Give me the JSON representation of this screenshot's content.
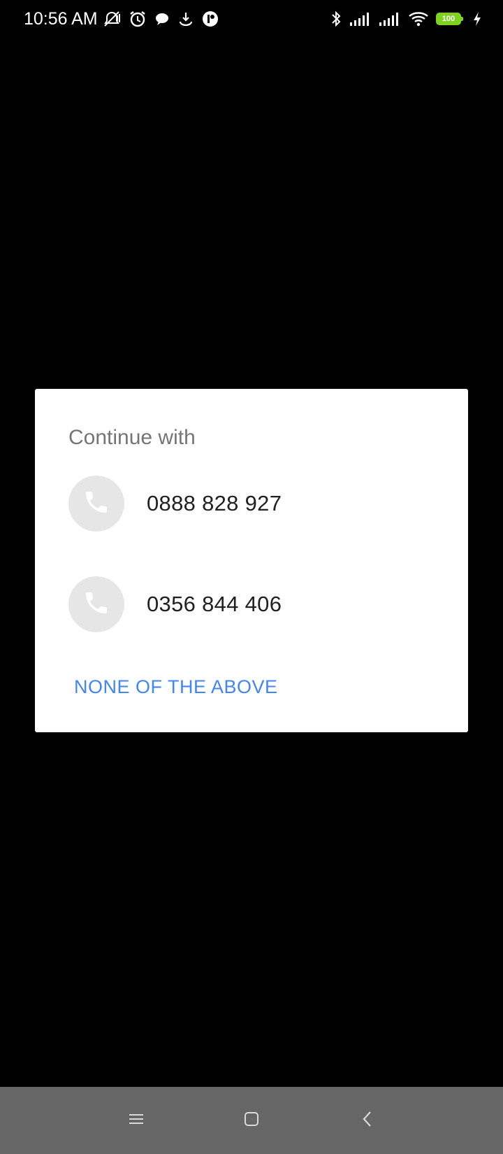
{
  "status_bar": {
    "time": "10:56 AM",
    "battery_level": "100",
    "colors": {
      "battery": "#7ed321",
      "icons": "#ffffff"
    },
    "left_icons": [
      "mute-icon",
      "alarm-icon",
      "chat-icon",
      "download-icon",
      "app-notification-icon"
    ],
    "right_icons": [
      "bluetooth-icon",
      "signal-icon",
      "signal-icon",
      "wifi-icon",
      "battery-icon",
      "charging-icon"
    ]
  },
  "dialog": {
    "title": "Continue with",
    "options": [
      {
        "number": "0888 828 927",
        "icon": "phone-icon"
      },
      {
        "number": "0356 844 406",
        "icon": "phone-icon"
      }
    ],
    "none_label": "NONE OF THE ABOVE",
    "colors": {
      "accent": "#4285f4",
      "avatar_bg": "#e6e6e6",
      "title": "#757575",
      "text": "#212121"
    }
  },
  "nav_bar": {
    "buttons": [
      "menu-icon",
      "home-icon",
      "back-icon"
    ],
    "colors": {
      "background": "#666666",
      "icon": "#d9d9d9"
    }
  }
}
